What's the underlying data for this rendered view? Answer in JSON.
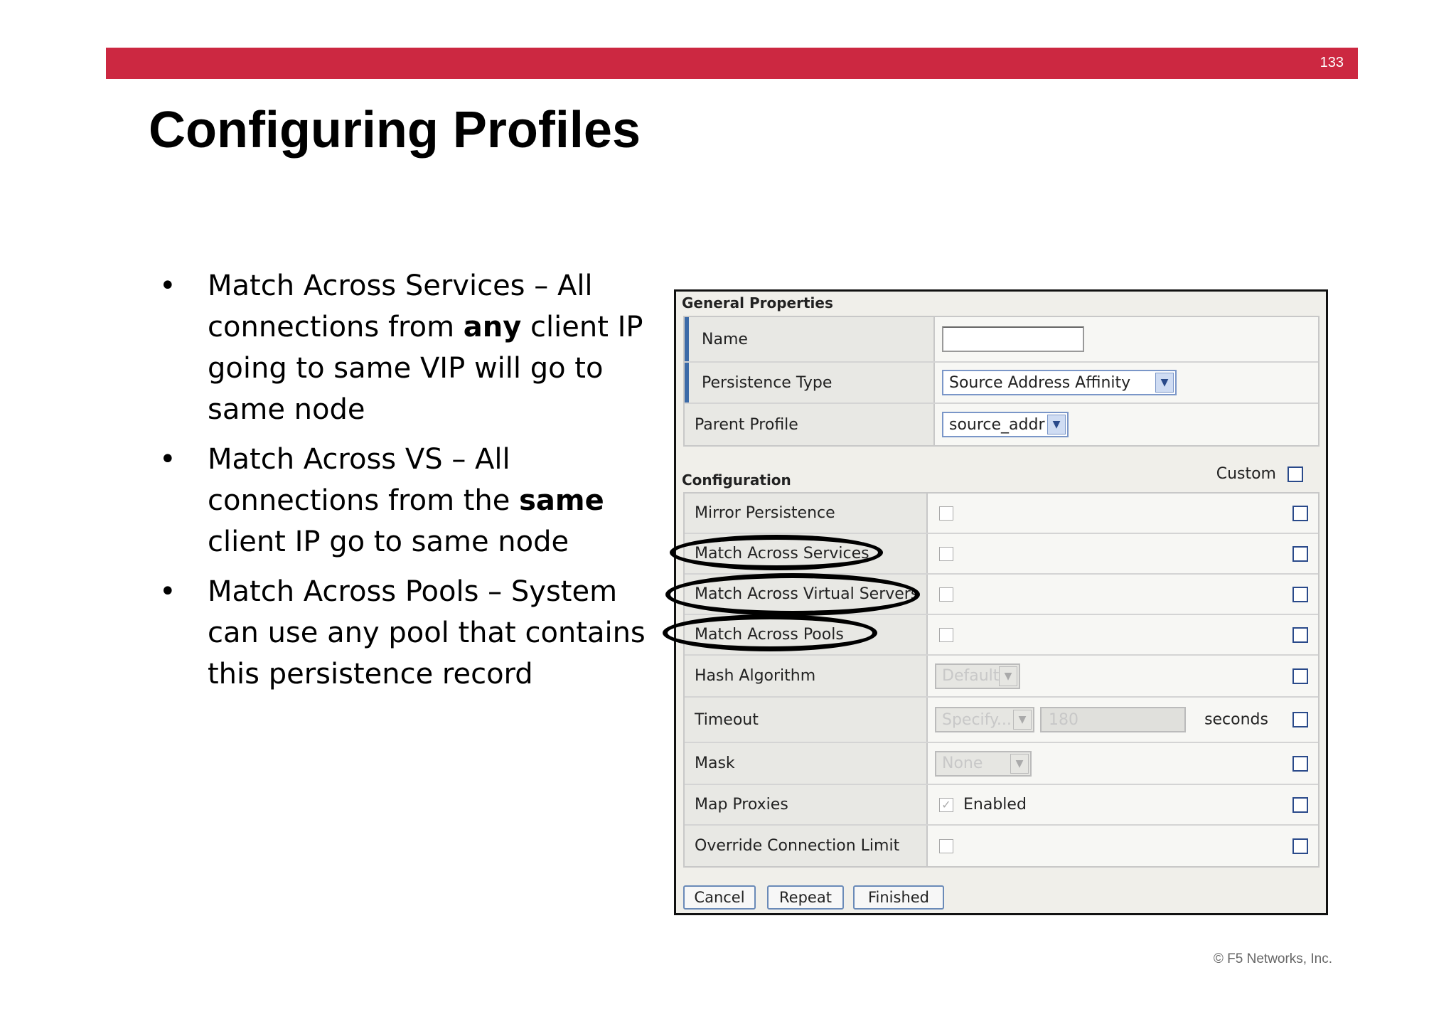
{
  "slide": {
    "page_number": "133",
    "title": "Configuring Profiles",
    "footer": "© F5 Networks, Inc.",
    "accent_color": "#cc2841"
  },
  "bullets": [
    {
      "pre": "Match Across Services – All connections from ",
      "bold": "any",
      "post": " client IP going to same VIP will go to same node"
    },
    {
      "pre": "Match Across VS – All connections from the ",
      "bold": "same",
      "post": " client IP go to same node"
    },
    {
      "pre": "Match Across Pools – System can use any pool that contains this persistence record",
      "bold": "",
      "post": ""
    }
  ],
  "form": {
    "general": {
      "title": "General Properties",
      "name_label": "Name",
      "name_value": "",
      "persistence_type_label": "Persistence Type",
      "persistence_type_value": "Source Address Affinity",
      "parent_profile_label": "Parent Profile",
      "parent_profile_value": "source_addr"
    },
    "config": {
      "title": "Configuration",
      "custom_label": "Custom",
      "rows": {
        "mirror": "Mirror Persistence",
        "services": "Match Across Services",
        "virtual": "Match Across Virtual Servers",
        "pools": "Match Across Pools",
        "hash": "Hash Algorithm",
        "hash_value": "Default",
        "timeout": "Timeout",
        "timeout_mode": "Specify...",
        "timeout_value": "180",
        "timeout_unit": "seconds",
        "mask": "Mask",
        "mask_value": "None",
        "map_proxies": "Map Proxies",
        "map_proxies_value": "Enabled",
        "override": "Override Connection Limit"
      }
    },
    "buttons": {
      "cancel": "Cancel",
      "repeat": "Repeat",
      "finished": "Finished"
    }
  }
}
